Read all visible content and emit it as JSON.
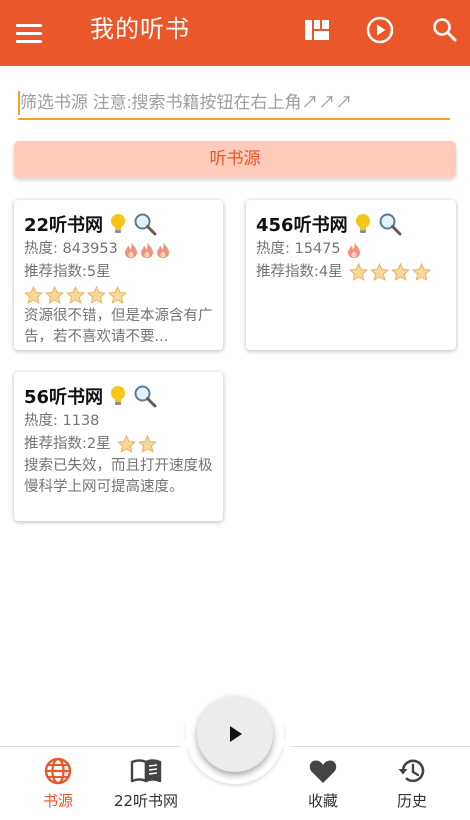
{
  "appbar": {
    "title": "我的听书",
    "icons": [
      "menu-icon",
      "grid-view-icon",
      "play-circle-icon",
      "search-icon"
    ]
  },
  "filter": {
    "value": "",
    "placeholder": "筛选书源 注意:搜索书籍按钮在右上角↗↗↗"
  },
  "section_button": {
    "label": "听书源"
  },
  "sources": [
    {
      "name": "22听书网",
      "heat_label": "热度: 843953",
      "heat_level": 3,
      "rating_label": "推荐指数:5星",
      "stars": 5,
      "description": "资源很不错，但是本源含有广告，若不喜欢请不要..."
    },
    {
      "name": "456听书网",
      "heat_label": "热度: 15475",
      "heat_level": 1,
      "rating_label": "推荐指数:4星",
      "stars": 4,
      "description": ""
    },
    {
      "name": "56听书网",
      "heat_label": "热度: 1138",
      "heat_level": 0,
      "rating_label": "推荐指数:2星",
      "stars": 2,
      "description": "搜索已失效，而且打开速度极慢科学上网可提高速度。"
    }
  ],
  "bottom_nav": [
    {
      "label": "书源",
      "icon": "globe-icon",
      "active": true
    },
    {
      "label": "22听书网",
      "icon": "book-open-icon",
      "active": false
    },
    {
      "label": "收藏",
      "icon": "heart-icon",
      "active": false
    },
    {
      "label": "历史",
      "icon": "history-icon",
      "active": false
    }
  ],
  "colors": {
    "primary": "#e9572b",
    "accent": "#f0a22b",
    "section_bg": "#ffcbbb",
    "star": "#f4c36f",
    "flame": "#f2917c"
  }
}
